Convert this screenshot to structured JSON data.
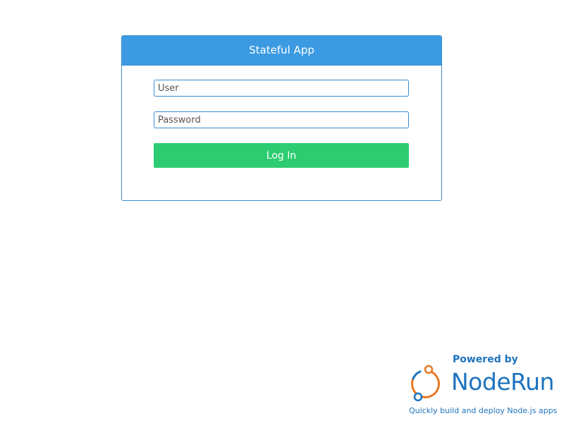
{
  "login": {
    "title": "Stateful App",
    "user_placeholder": "User",
    "password_placeholder": "Password",
    "login_label": "Log In"
  },
  "badge": {
    "powered_by": "Powered by",
    "brand": "NodeRun",
    "tagline": "Quickly build and deploy Node.js apps",
    "logo_icon": "noderun-logo-icon"
  },
  "colors": {
    "header_blue": "#3b9ae1",
    "border_blue": "#3a8fd1",
    "button_green": "#2ecc71",
    "brand_blue": "#1e73be",
    "brand_orange": "#e87722"
  }
}
